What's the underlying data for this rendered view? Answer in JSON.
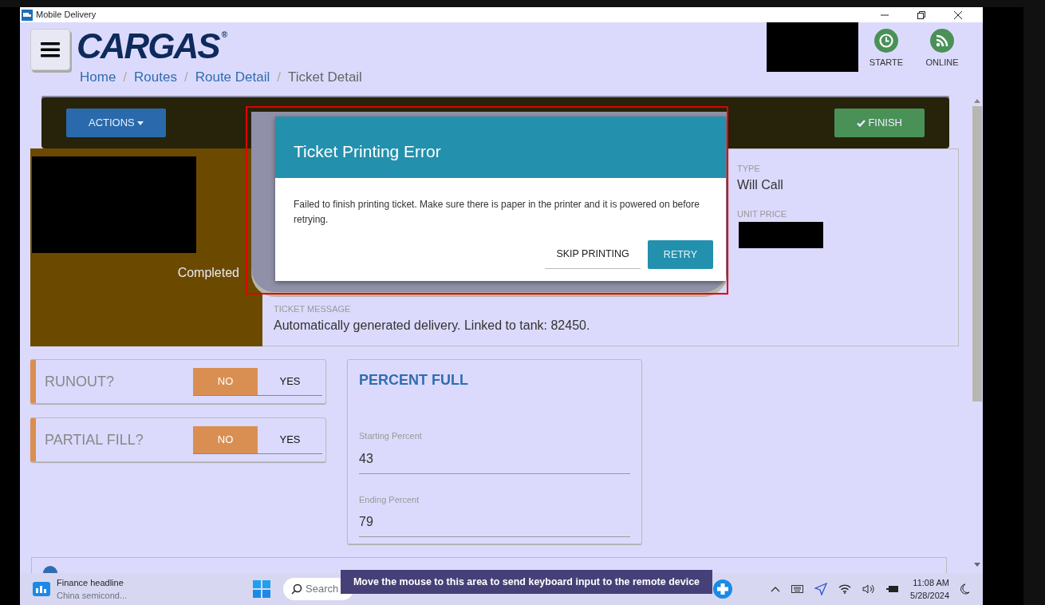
{
  "window": {
    "title": "Mobile Delivery"
  },
  "header": {
    "logo": "CARGAS",
    "logo_mark": "®",
    "separator": "/",
    "breadcrumb": [
      {
        "label": "Home",
        "current": false
      },
      {
        "label": "Routes",
        "current": false
      },
      {
        "label": "Route Detail",
        "current": false
      },
      {
        "label": "Ticket Detail",
        "current": true
      }
    ],
    "status": [
      {
        "label": "STARTE",
        "kind": "clock"
      },
      {
        "label": "ONLINE",
        "kind": "feed"
      }
    ]
  },
  "toolbar": {
    "actions": "ACTIONS",
    "finish": "FINISH"
  },
  "ticket": {
    "status": "Completed",
    "type_label": "TYPE",
    "type": "Will Call",
    "unit_price_label": "UNIT PRICE",
    "message_label": "TICKET MESSAGE",
    "message": "Automatically generated delivery. Linked to tank: 82450."
  },
  "toggles": [
    {
      "label": "RUNOUT?",
      "options": [
        {
          "label": "NO",
          "selected": true
        },
        {
          "label": "YES",
          "selected": false
        }
      ]
    },
    {
      "label": "PARTIAL FILL?",
      "options": [
        {
          "label": "NO",
          "selected": true
        },
        {
          "label": "YES",
          "selected": false
        }
      ]
    }
  ],
  "percent_full": {
    "title": "PERCENT FULL",
    "fields": [
      {
        "label": "Starting Percent",
        "value": "43"
      },
      {
        "label": "Ending Percent",
        "value": "79"
      }
    ]
  },
  "dialog": {
    "title": "Ticket Printing Error",
    "message": "Failed to finish printing ticket. Make sure there is paper in the printer and it is powered on before retrying.",
    "buttons": [
      {
        "label": "SKIP PRINTING",
        "kind": "flat"
      },
      {
        "label": "RETRY",
        "kind": "raised"
      }
    ]
  },
  "taskbar": {
    "news_title": "Finance headline",
    "news_subtitle": "China semicond...",
    "search_placeholder": "Search",
    "banner": "Move the mouse to this area to send keyboard input to the remote device",
    "time": "11:08 AM",
    "date": "5/28/2024"
  }
}
